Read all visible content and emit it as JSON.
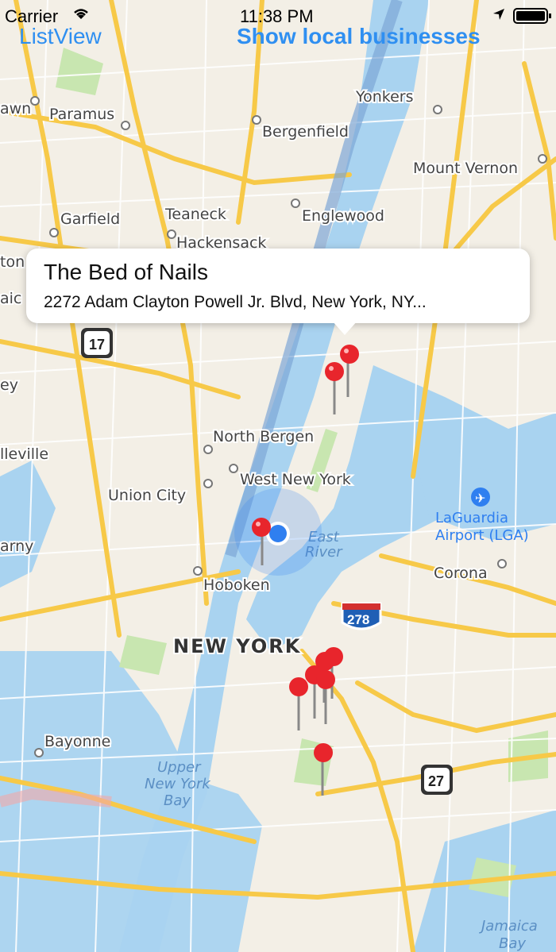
{
  "status": {
    "carrier": "Carrier",
    "time": "11:38 PM"
  },
  "nav": {
    "left_label": "ListView",
    "right_label": "Show local businesses"
  },
  "callout": {
    "title": "The Bed of Nails",
    "address": "2272 Adam Clayton Powell Jr. Blvd, New York, NY..."
  },
  "map": {
    "places": [
      "Yonkers",
      "Paramus",
      "Bergenfield",
      "Mount Vernon",
      "Garfield",
      "Teaneck",
      "Englewood",
      "Hackensack",
      "North Bergen",
      "West New York",
      "Union City",
      "Hoboken",
      "Corona",
      "NEW YORK",
      "Bayonne",
      "LaGuardia Airport (LGA)",
      "East River",
      "Upper New York Bay",
      "Jamaica Bay",
      "awn",
      "ton",
      "aic",
      "ey",
      "lleville",
      "arny"
    ],
    "shields": [
      "17",
      "278",
      "27"
    ],
    "colors": {
      "land": "#f3efe6",
      "water": "#a9d3f0",
      "park": "#c8e6b0",
      "road_major": "#f7c948",
      "road_minor": "#ffffff",
      "pin": "#e8252c",
      "user_location": "#2f7ff0",
      "accent": "#2f8ff1"
    }
  }
}
